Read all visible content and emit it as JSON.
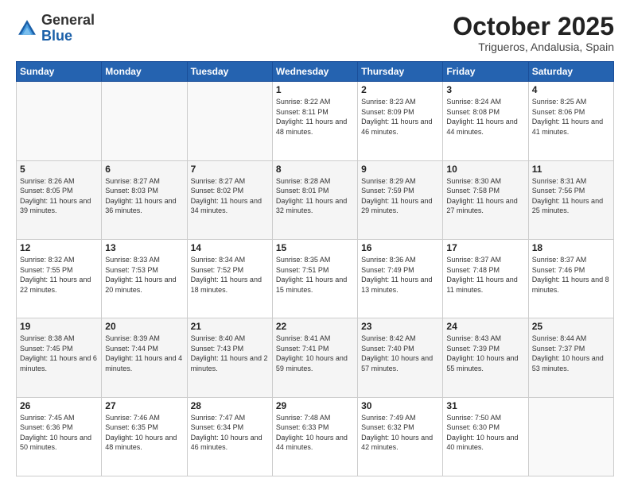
{
  "header": {
    "logo_general": "General",
    "logo_blue": "Blue",
    "title": "October 2025",
    "location": "Trigueros, Andalusia, Spain"
  },
  "days_of_week": [
    "Sunday",
    "Monday",
    "Tuesday",
    "Wednesday",
    "Thursday",
    "Friday",
    "Saturday"
  ],
  "weeks": [
    [
      {
        "day": "",
        "sunrise": "",
        "sunset": "",
        "daylight": ""
      },
      {
        "day": "",
        "sunrise": "",
        "sunset": "",
        "daylight": ""
      },
      {
        "day": "",
        "sunrise": "",
        "sunset": "",
        "daylight": ""
      },
      {
        "day": "1",
        "sunrise": "Sunrise: 8:22 AM",
        "sunset": "Sunset: 8:11 PM",
        "daylight": "Daylight: 11 hours and 48 minutes."
      },
      {
        "day": "2",
        "sunrise": "Sunrise: 8:23 AM",
        "sunset": "Sunset: 8:09 PM",
        "daylight": "Daylight: 11 hours and 46 minutes."
      },
      {
        "day": "3",
        "sunrise": "Sunrise: 8:24 AM",
        "sunset": "Sunset: 8:08 PM",
        "daylight": "Daylight: 11 hours and 44 minutes."
      },
      {
        "day": "4",
        "sunrise": "Sunrise: 8:25 AM",
        "sunset": "Sunset: 8:06 PM",
        "daylight": "Daylight: 11 hours and 41 minutes."
      }
    ],
    [
      {
        "day": "5",
        "sunrise": "Sunrise: 8:26 AM",
        "sunset": "Sunset: 8:05 PM",
        "daylight": "Daylight: 11 hours and 39 minutes."
      },
      {
        "day": "6",
        "sunrise": "Sunrise: 8:27 AM",
        "sunset": "Sunset: 8:03 PM",
        "daylight": "Daylight: 11 hours and 36 minutes."
      },
      {
        "day": "7",
        "sunrise": "Sunrise: 8:27 AM",
        "sunset": "Sunset: 8:02 PM",
        "daylight": "Daylight: 11 hours and 34 minutes."
      },
      {
        "day": "8",
        "sunrise": "Sunrise: 8:28 AM",
        "sunset": "Sunset: 8:01 PM",
        "daylight": "Daylight: 11 hours and 32 minutes."
      },
      {
        "day": "9",
        "sunrise": "Sunrise: 8:29 AM",
        "sunset": "Sunset: 7:59 PM",
        "daylight": "Daylight: 11 hours and 29 minutes."
      },
      {
        "day": "10",
        "sunrise": "Sunrise: 8:30 AM",
        "sunset": "Sunset: 7:58 PM",
        "daylight": "Daylight: 11 hours and 27 minutes."
      },
      {
        "day": "11",
        "sunrise": "Sunrise: 8:31 AM",
        "sunset": "Sunset: 7:56 PM",
        "daylight": "Daylight: 11 hours and 25 minutes."
      }
    ],
    [
      {
        "day": "12",
        "sunrise": "Sunrise: 8:32 AM",
        "sunset": "Sunset: 7:55 PM",
        "daylight": "Daylight: 11 hours and 22 minutes."
      },
      {
        "day": "13",
        "sunrise": "Sunrise: 8:33 AM",
        "sunset": "Sunset: 7:53 PM",
        "daylight": "Daylight: 11 hours and 20 minutes."
      },
      {
        "day": "14",
        "sunrise": "Sunrise: 8:34 AM",
        "sunset": "Sunset: 7:52 PM",
        "daylight": "Daylight: 11 hours and 18 minutes."
      },
      {
        "day": "15",
        "sunrise": "Sunrise: 8:35 AM",
        "sunset": "Sunset: 7:51 PM",
        "daylight": "Daylight: 11 hours and 15 minutes."
      },
      {
        "day": "16",
        "sunrise": "Sunrise: 8:36 AM",
        "sunset": "Sunset: 7:49 PM",
        "daylight": "Daylight: 11 hours and 13 minutes."
      },
      {
        "day": "17",
        "sunrise": "Sunrise: 8:37 AM",
        "sunset": "Sunset: 7:48 PM",
        "daylight": "Daylight: 11 hours and 11 minutes."
      },
      {
        "day": "18",
        "sunrise": "Sunrise: 8:37 AM",
        "sunset": "Sunset: 7:46 PM",
        "daylight": "Daylight: 11 hours and 8 minutes."
      }
    ],
    [
      {
        "day": "19",
        "sunrise": "Sunrise: 8:38 AM",
        "sunset": "Sunset: 7:45 PM",
        "daylight": "Daylight: 11 hours and 6 minutes."
      },
      {
        "day": "20",
        "sunrise": "Sunrise: 8:39 AM",
        "sunset": "Sunset: 7:44 PM",
        "daylight": "Daylight: 11 hours and 4 minutes."
      },
      {
        "day": "21",
        "sunrise": "Sunrise: 8:40 AM",
        "sunset": "Sunset: 7:43 PM",
        "daylight": "Daylight: 11 hours and 2 minutes."
      },
      {
        "day": "22",
        "sunrise": "Sunrise: 8:41 AM",
        "sunset": "Sunset: 7:41 PM",
        "daylight": "Daylight: 10 hours and 59 minutes."
      },
      {
        "day": "23",
        "sunrise": "Sunrise: 8:42 AM",
        "sunset": "Sunset: 7:40 PM",
        "daylight": "Daylight: 10 hours and 57 minutes."
      },
      {
        "day": "24",
        "sunrise": "Sunrise: 8:43 AM",
        "sunset": "Sunset: 7:39 PM",
        "daylight": "Daylight: 10 hours and 55 minutes."
      },
      {
        "day": "25",
        "sunrise": "Sunrise: 8:44 AM",
        "sunset": "Sunset: 7:37 PM",
        "daylight": "Daylight: 10 hours and 53 minutes."
      }
    ],
    [
      {
        "day": "26",
        "sunrise": "Sunrise: 7:45 AM",
        "sunset": "Sunset: 6:36 PM",
        "daylight": "Daylight: 10 hours and 50 minutes."
      },
      {
        "day": "27",
        "sunrise": "Sunrise: 7:46 AM",
        "sunset": "Sunset: 6:35 PM",
        "daylight": "Daylight: 10 hours and 48 minutes."
      },
      {
        "day": "28",
        "sunrise": "Sunrise: 7:47 AM",
        "sunset": "Sunset: 6:34 PM",
        "daylight": "Daylight: 10 hours and 46 minutes."
      },
      {
        "day": "29",
        "sunrise": "Sunrise: 7:48 AM",
        "sunset": "Sunset: 6:33 PM",
        "daylight": "Daylight: 10 hours and 44 minutes."
      },
      {
        "day": "30",
        "sunrise": "Sunrise: 7:49 AM",
        "sunset": "Sunset: 6:32 PM",
        "daylight": "Daylight: 10 hours and 42 minutes."
      },
      {
        "day": "31",
        "sunrise": "Sunrise: 7:50 AM",
        "sunset": "Sunset: 6:30 PM",
        "daylight": "Daylight: 10 hours and 40 minutes."
      },
      {
        "day": "",
        "sunrise": "",
        "sunset": "",
        "daylight": ""
      }
    ]
  ]
}
